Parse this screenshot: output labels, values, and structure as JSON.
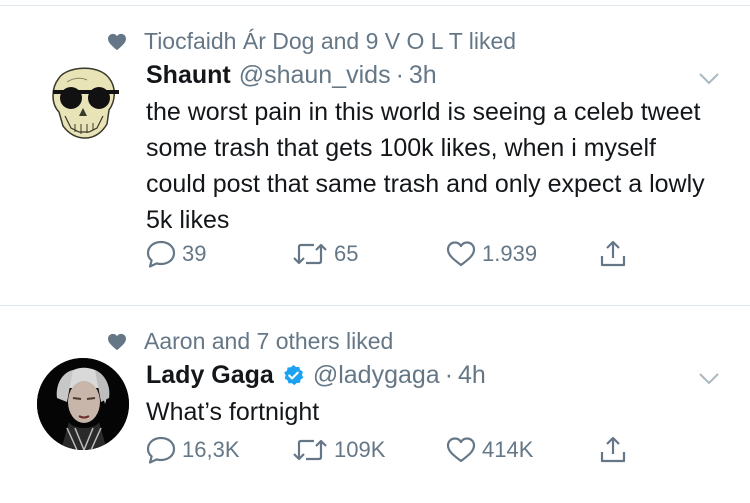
{
  "tweets": [
    {
      "social_context": "Tiocfaidh Ár Dog and 9 V O L T liked",
      "name": "Shaunt",
      "handle": "@shaun_vids",
      "separator": "·",
      "time": "3h",
      "verified": false,
      "text": "the worst pain in this world is seeing a celeb tweet some trash that gets 100k likes, when i myself could post that same trash and only expect a lowly 5k likes",
      "replies": "39",
      "retweets": "65",
      "likes": "1.939",
      "avatar_icon": "skull-with-sunglasses-avatar"
    },
    {
      "social_context": "Aaron and 7 others liked",
      "name": "Lady Gaga",
      "handle": "@ladygaga",
      "separator": "·",
      "time": "4h",
      "verified": true,
      "text": "What’s fortnight",
      "replies": "16,3K",
      "retweets": "109K",
      "likes": "414K",
      "avatar_icon": "portrait-avatar"
    }
  ],
  "colors": {
    "secondary_text": "#657786",
    "primary_text": "#14171a",
    "divider": "#e1e8ed",
    "verified_blue": "#1da1f2"
  },
  "icons": [
    "heart-icon",
    "reply-icon",
    "retweet-icon",
    "like-icon",
    "share-icon",
    "caret-down-icon",
    "verified-badge-icon"
  ]
}
